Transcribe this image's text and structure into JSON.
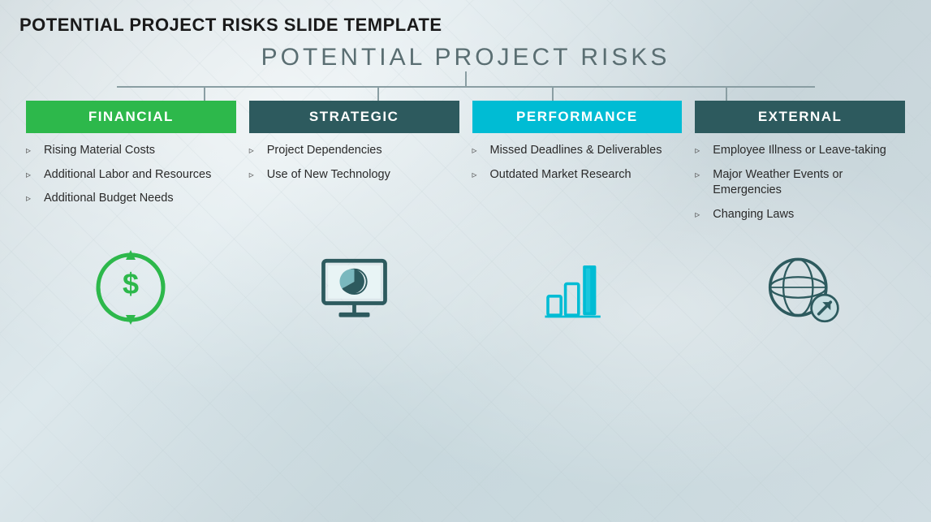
{
  "page": {
    "title": "POTENTIAL PROJECT RISKS SLIDE TEMPLATE",
    "main_heading": "POTENTIAL PROJECT RISKS"
  },
  "columns": [
    {
      "id": "financial",
      "header": "FINANCIAL",
      "header_class": "header-financial",
      "items": [
        "Rising Material Costs",
        "Additional Labor and Resources",
        "Additional Budget Needs"
      ]
    },
    {
      "id": "strategic",
      "header": "STRATEGIC",
      "header_class": "header-strategic",
      "items": [
        "Project Dependencies",
        "Use of New Technology"
      ]
    },
    {
      "id": "performance",
      "header": "PERFORMANCE",
      "header_class": "header-performance",
      "items": [
        "Missed Deadlines & Deliverables",
        "Outdated Market Research"
      ]
    },
    {
      "id": "external",
      "header": "EXTERNAL",
      "header_class": "header-strategic",
      "items": [
        "Employee Illness or Leave-taking",
        "Major Weather Events or Emergencies",
        "Changing Laws"
      ]
    }
  ]
}
